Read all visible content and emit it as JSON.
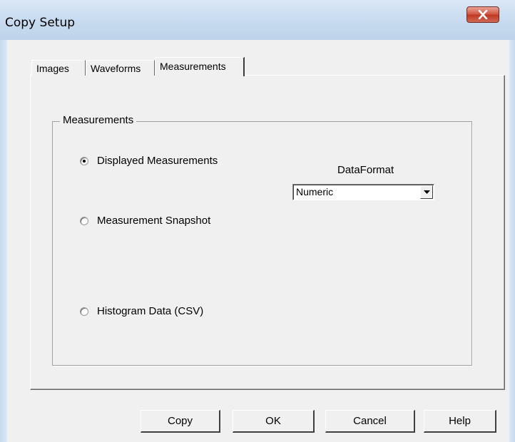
{
  "window": {
    "title": "Copy Setup"
  },
  "tabs": [
    {
      "label": "Images",
      "active": false
    },
    {
      "label": "Waveforms",
      "active": false
    },
    {
      "label": "Measurements",
      "active": true
    }
  ],
  "group": {
    "title": "Measurements",
    "options": [
      {
        "label": "Displayed Measurements",
        "checked": true
      },
      {
        "label": "Measurement Snapshot",
        "checked": false
      },
      {
        "label": "Histogram Data (CSV)",
        "checked": false
      }
    ]
  },
  "data_format": {
    "label": "DataFormat",
    "value": "Numeric"
  },
  "buttons": {
    "copy": "Copy",
    "ok": "OK",
    "cancel": "Cancel",
    "help": "Help"
  },
  "icons": {
    "close": "close-icon",
    "dropdown": "chevron-down-icon"
  }
}
